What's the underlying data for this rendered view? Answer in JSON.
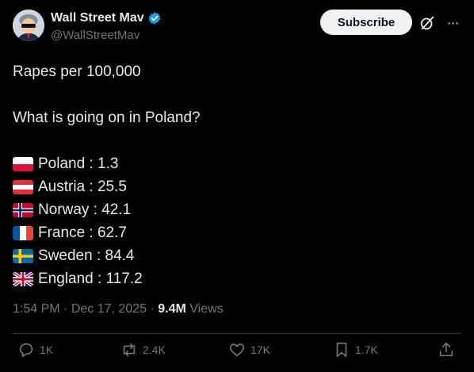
{
  "author": {
    "display_name": "Wall Street Mav",
    "handle": "@WallStreetMav",
    "avatar": "avatar-icon"
  },
  "header": {
    "subscribe_label": "Subscribe"
  },
  "post": {
    "line1": "Rapes per 100,000",
    "line2": "What is going on in Poland?",
    "stats": [
      {
        "flag": "poland-flag-icon",
        "text": "Poland : 1.3"
      },
      {
        "flag": "austria-flag-icon",
        "text": "Austria : 25.5"
      },
      {
        "flag": "norway-flag-icon",
        "text": "Norway : 42.1"
      },
      {
        "flag": "france-flag-icon",
        "text": "France : 62.7"
      },
      {
        "flag": "sweden-flag-icon",
        "text": "Sweden : 84.4"
      },
      {
        "flag": "uk-flag-icon",
        "text": "England : 117.2"
      }
    ]
  },
  "meta": {
    "time": "1:54 PM",
    "date": "Dec 17, 2025",
    "views_count": "9.4M",
    "views_label": "Views"
  },
  "actions": {
    "replies": "1K",
    "reposts": "2.4K",
    "likes": "17K",
    "bookmarks": "1.7K"
  },
  "colors": {
    "background": "#000000",
    "text": "#e7e9ea",
    "muted": "#71767b",
    "verified": "#1d9bf0"
  }
}
